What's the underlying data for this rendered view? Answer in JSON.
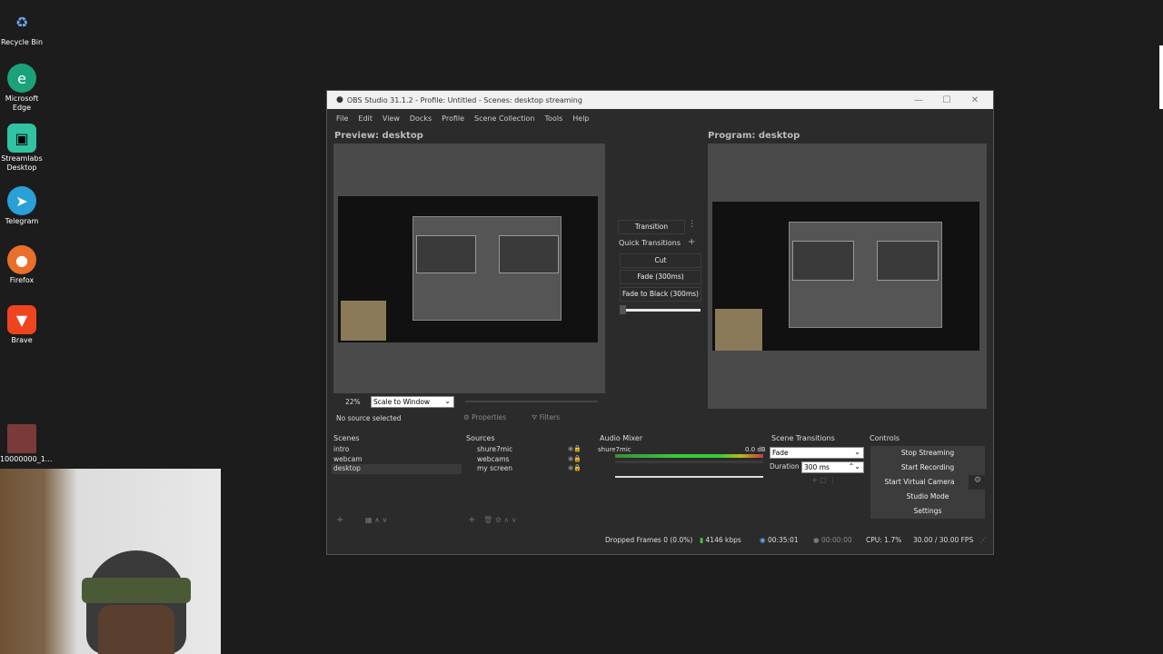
{
  "desktop": {
    "icons": [
      {
        "label": "Recycle Bin",
        "icon": "recycle-bin-icon",
        "color": "#2b6fc9"
      },
      {
        "label": "Microsoft Edge",
        "icon": "edge-icon",
        "color": "#1aa37a"
      },
      {
        "label": "Streamlabs Desktop",
        "icon": "streamlabs-icon",
        "color": "#31c3a2"
      },
      {
        "label": "Telegram",
        "icon": "telegram-icon",
        "color": "#2aa0d8"
      },
      {
        "label": "Firefox",
        "icon": "firefox-icon",
        "color": "#e8702a"
      },
      {
        "label": "Brave",
        "icon": "brave-icon",
        "color": "#f0441e"
      },
      {
        "label": "10000000_1...",
        "icon": "video-file-icon",
        "color": "#7a3a3a"
      }
    ]
  },
  "obs": {
    "title": "OBS Studio 31.1.2 - Profile: Untitled - Scenes: desktop streaming",
    "menu": [
      "File",
      "Edit",
      "View",
      "Docks",
      "Profile",
      "Scene Collection",
      "Tools",
      "Help"
    ],
    "preview_title": "Preview: desktop",
    "program_title": "Program: desktop",
    "zoom": "22%",
    "scale_mode": "Scale to Window",
    "transition": {
      "label": "Transition",
      "quick_label": "Quick Transitions",
      "items": [
        "Cut",
        "Fade (300ms)",
        "Fade to Black (300ms)"
      ]
    },
    "source_bar": {
      "no_source": "No source selected",
      "properties": "Properties",
      "filters": "Filters"
    },
    "scenes": {
      "title": "Scenes",
      "items": [
        "intro",
        "webcam",
        "desktop"
      ]
    },
    "sources": {
      "title": "Sources",
      "items": [
        "shure7mic",
        "webcams",
        "my screen"
      ]
    },
    "audio_mixer": {
      "title": "Audio Mixer",
      "channel": "shure7mic",
      "level": "0.0 dB"
    },
    "scene_transitions": {
      "title": "Scene Transitions",
      "selected": "Fade",
      "duration_label": "Duration",
      "duration": "300 ms"
    },
    "controls": {
      "title": "Controls",
      "buttons": [
        "Stop Streaming",
        "Start Recording",
        "Start Virtual Camera",
        "Studio Mode",
        "Settings"
      ]
    },
    "status": {
      "dropped": "Dropped Frames 0 (0.0%)",
      "kbps": "4146 kbps",
      "stream_time": "00:35:01",
      "rec_time": "00:00:00",
      "cpu": "CPU: 1.7%",
      "fps": "30.00 / 30.00 FPS"
    }
  }
}
